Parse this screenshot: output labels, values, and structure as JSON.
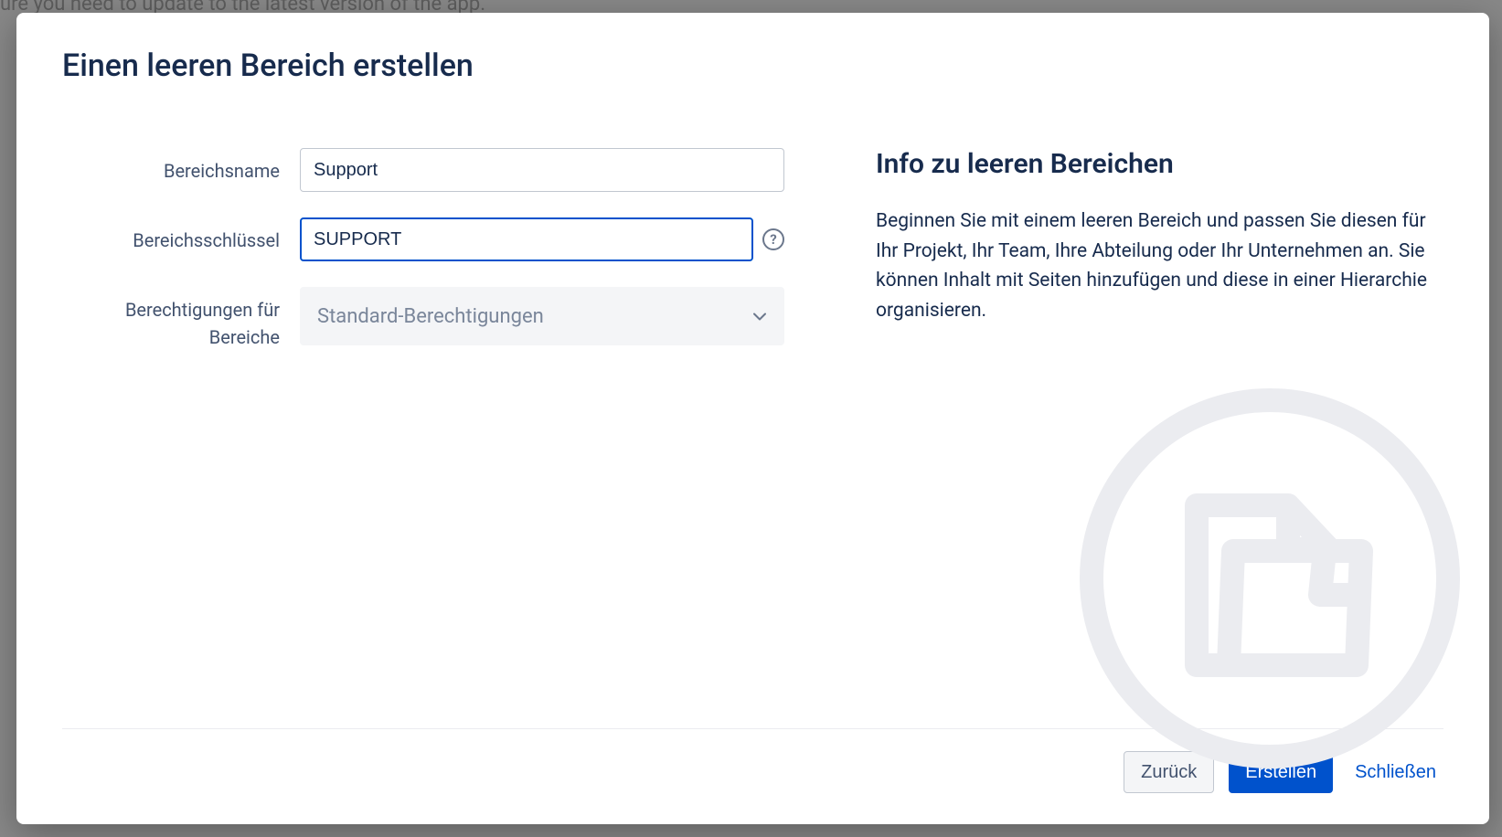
{
  "background": {
    "topText": "ure you need to update to the latest version of the app."
  },
  "modal": {
    "title": "Einen leeren Bereich erstellen",
    "form": {
      "nameLabel": "Bereichsname",
      "nameValue": "Support",
      "keyLabel": "Bereichsschlüssel",
      "keyValue": "SUPPORT",
      "permissionsLabel": "Berechtigungen für Bereiche",
      "permissionsValue": "Standard-Berechtigungen"
    },
    "info": {
      "title": "Info zu leeren Bereichen",
      "text": "Beginnen Sie mit einem leeren Bereich und passen Sie diesen für Ihr Projekt, Ihr Team, Ihre Abteilung oder Ihr Unternehmen an. Sie können Inhalt mit Seiten hinzufügen und diese in einer Hierarchie organisieren."
    },
    "footer": {
      "back": "Zurück",
      "create": "Erstellen",
      "close": "Schließen"
    }
  }
}
